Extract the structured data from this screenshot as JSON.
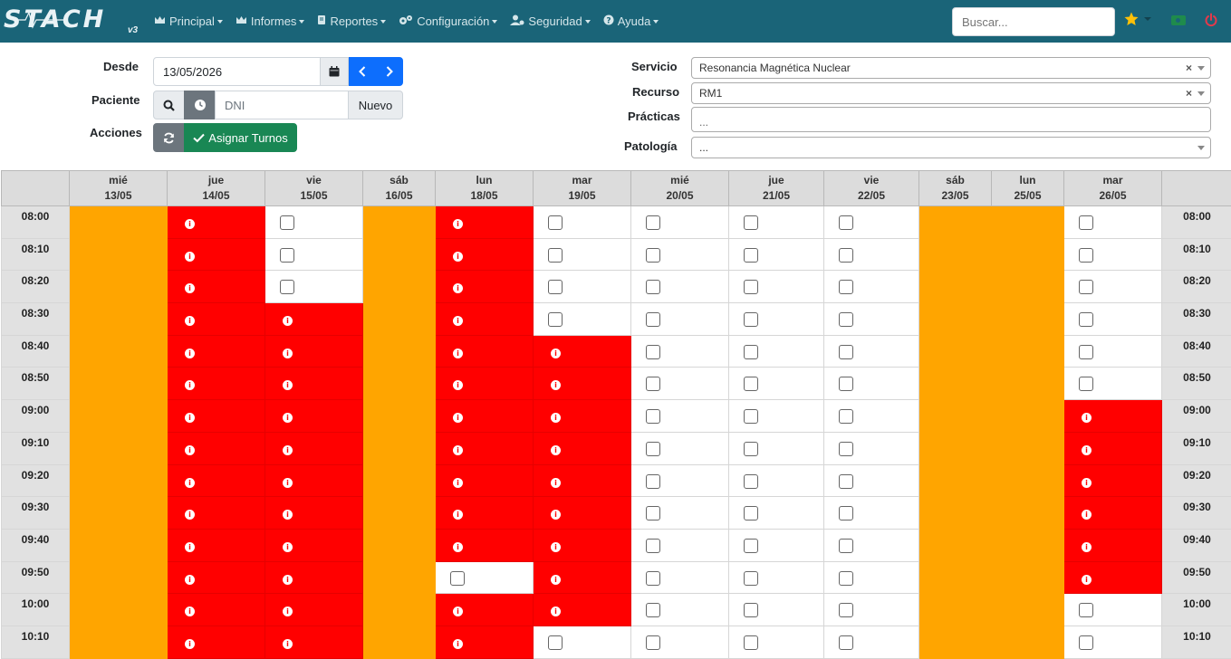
{
  "app": {
    "logo_text": "STACH",
    "logo_version": "v3"
  },
  "nav": {
    "menu": [
      {
        "label": "Principal",
        "icon": "crown-icon"
      },
      {
        "label": "Informes",
        "icon": "crown-icon"
      },
      {
        "label": "Reportes",
        "icon": "book-icon"
      },
      {
        "label": "Configuración",
        "icon": "cogs-icon"
      },
      {
        "label": "Seguridad",
        "icon": "user-cog-icon"
      },
      {
        "label": "Ayuda",
        "icon": "question-circle-icon"
      }
    ],
    "search_placeholder": "Buscar...",
    "colors": {
      "bar": "#1a6478",
      "star": "#ffc107",
      "money": "#1f8b4c",
      "power": "#e4394a"
    }
  },
  "form": {
    "desde_label": "Desde",
    "desde_value": "13/05/2026",
    "paciente_label": "Paciente",
    "dni_placeholder": "DNI",
    "nuevo_label": "Nuevo",
    "acciones_label": "Acciones",
    "asignar_label": "Asignar Turnos",
    "servicio_label": "Servicio",
    "servicio_value": "Resonancia Magnética Nuclear",
    "recurso_label": "Recurso",
    "recurso_value": "RM1",
    "practicas_label": "Prácticas",
    "practicas_value": "...",
    "patologia_label": "Patología",
    "patologia_value": "...",
    "clear_symbol": "×"
  },
  "calendar": {
    "days": [
      {
        "dow": "mié",
        "date": "13/05"
      },
      {
        "dow": "jue",
        "date": "14/05"
      },
      {
        "dow": "vie",
        "date": "15/05"
      },
      {
        "dow": "sáb",
        "date": "16/05"
      },
      {
        "dow": "lun",
        "date": "18/05"
      },
      {
        "dow": "mar",
        "date": "19/05"
      },
      {
        "dow": "mié",
        "date": "20/05"
      },
      {
        "dow": "jue",
        "date": "21/05"
      },
      {
        "dow": "vie",
        "date": "22/05"
      },
      {
        "dow": "sáb",
        "date": "23/05"
      },
      {
        "dow": "lun",
        "date": "25/05"
      },
      {
        "dow": "mar",
        "date": "26/05"
      }
    ],
    "times": [
      "08:00",
      "08:10",
      "08:20",
      "08:30",
      "08:40",
      "08:50",
      "09:00",
      "09:10",
      "09:20",
      "09:30",
      "09:40",
      "09:50",
      "10:00",
      "10:10"
    ],
    "legend": {
      "W": "unavailable",
      "B": "occupied",
      "F": "free"
    },
    "colors": {
      "unavailable": "#ffa500",
      "occupied": "#ff0000",
      "free": "#ffffff"
    },
    "info_glyph": "i",
    "grid": [
      "WBFWBFFFFWWF",
      "WBFWBFFFFWWF",
      "WBFWBFFFFWWF",
      "WBBWBFFFFWWF",
      "WBBWBBFFFWWF",
      "WBBWBBFFFWWF",
      "WBBWBBFFFWWB",
      "WBBWBBFFFWWB",
      "WBBWBBFFFWWB",
      "WBBWBBFFFWWB",
      "WBBWBBFFFWWB",
      "WBBWFBFFFWWB",
      "WBBWBBFFFWWF",
      "WBBWBFFFFWWF"
    ]
  }
}
